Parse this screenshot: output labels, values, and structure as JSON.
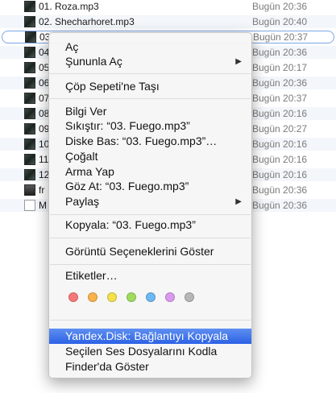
{
  "files": [
    {
      "name": "01. Roza.mp3",
      "date": "Bugün 20:36",
      "thumb": "album-art"
    },
    {
      "name": "02. Shecharhoret.mp3",
      "date": "Bugün 20:40",
      "thumb": "album-art"
    },
    {
      "name": "03",
      "date": "Bugün 20:37",
      "thumb": "album-art",
      "selected": true
    },
    {
      "name": "04",
      "date": "Bugün 20:36",
      "thumb": "album-art"
    },
    {
      "name": "05",
      "date": "Bugün 20:17",
      "thumb": "album-art"
    },
    {
      "name": "06",
      "date": "Bugün 20:36",
      "thumb": "album-art"
    },
    {
      "name": "07",
      "date": "Bugün 20:37",
      "thumb": "album-art"
    },
    {
      "name": "08",
      "date": "Bugün 20:16",
      "thumb": "album-art"
    },
    {
      "name": "09",
      "date": "Bugün 20:27",
      "thumb": "album-art"
    },
    {
      "name": "10",
      "date": "Bugün 20:16",
      "thumb": "album-art"
    },
    {
      "name": "11",
      "date": "Bugün 20:16",
      "thumb": "album-art"
    },
    {
      "name": "12",
      "date": "Bugün 20:16",
      "thumb": "album-art"
    },
    {
      "name": "fr",
      "date": "Bugün 20:36",
      "thumb": "film"
    },
    {
      "name": "M",
      "date": "Bugün 20:36",
      "thumb": "document"
    }
  ],
  "context_menu": {
    "open": "Aç",
    "open_with": "Şununla Aç",
    "move_to_trash": "Çöp Sepeti'ne Taşı",
    "get_info": "Bilgi Ver",
    "compress": "Sıkıştır: “03. Fuego.mp3”",
    "burn": "Diske Bas: “03. Fuego.mp3”…",
    "duplicate": "Çoğalt",
    "make_alias": "Arma Yap",
    "quick_look": "Göz At: “03. Fuego.mp3”",
    "share": "Paylaş",
    "copy": "Kopyala: “03. Fuego.mp3”",
    "show_view_options": "Görüntü Seçeneklerini Göster",
    "tags": "Etiketler…",
    "tag_colors": [
      "#f7787a",
      "#f9b24c",
      "#f3e04a",
      "#9fdc5e",
      "#6db9f3",
      "#d99af0",
      "#b7b7b7"
    ],
    "yandex_copy_link": "Yandex.Disk: Bağlantıyı Kopyala",
    "encode_audio": "Seçilen Ses Dosyalarını Kodla",
    "reveal_in_finder": "Finder'da Göster"
  }
}
